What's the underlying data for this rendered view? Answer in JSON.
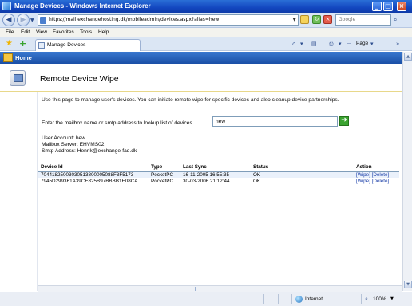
{
  "window": {
    "title": "Manage Devices - Windows Internet Explorer"
  },
  "address_bar": {
    "url": "https://mail.exchangehosting.dk/mobileadmin/devices.aspx?alias=hew",
    "search_placeholder": "Google"
  },
  "menu": {
    "items": [
      "File",
      "Edit",
      "View",
      "Favorites",
      "Tools",
      "Help"
    ]
  },
  "tab": {
    "label": "Manage Devices"
  },
  "toolbar": {
    "page_label": "Page"
  },
  "homebar": {
    "label": "Home"
  },
  "page": {
    "title": "Remote Device Wipe",
    "description": "Use this page to manage user's devices. You can initiate remote wipe for specific devices and also cleanup device partnerships.",
    "lookup_label": "Enter the mailbox name or smtp address to lookup list of devices",
    "lookup_value": "hew",
    "user_account": "User Account: hew",
    "mailbox_server": "Mailbox Server: EHVMS02",
    "smtp_address": "Smtp Address: Henrik@exchange-faq.dk"
  },
  "table": {
    "headers": [
      "Device Id",
      "Type",
      "Last Sync",
      "Status",
      "Action"
    ],
    "rows": [
      {
        "device_id": "70441825003030513800005088F3F5173",
        "type": "PocketPC",
        "last_sync": "16-11-2005 16:55:35",
        "status": "OK",
        "wipe": "[Wipe]",
        "delete": "[Delete]"
      },
      {
        "device_id": "7945D299361A39CE825B97BBBB1E08CA",
        "type": "PocketPC",
        "last_sync": "30-03-2006 21:12:44",
        "status": "OK",
        "wipe": "[Wipe]",
        "delete": "[Delete]"
      }
    ]
  },
  "statusbar": {
    "zone": "Internet",
    "zoom": "100%"
  },
  "colors": {
    "titlebar": "#1347c0",
    "homebar": "#2a62bb",
    "header_rule": "#e8d88a",
    "link": "#1a3ea8"
  }
}
